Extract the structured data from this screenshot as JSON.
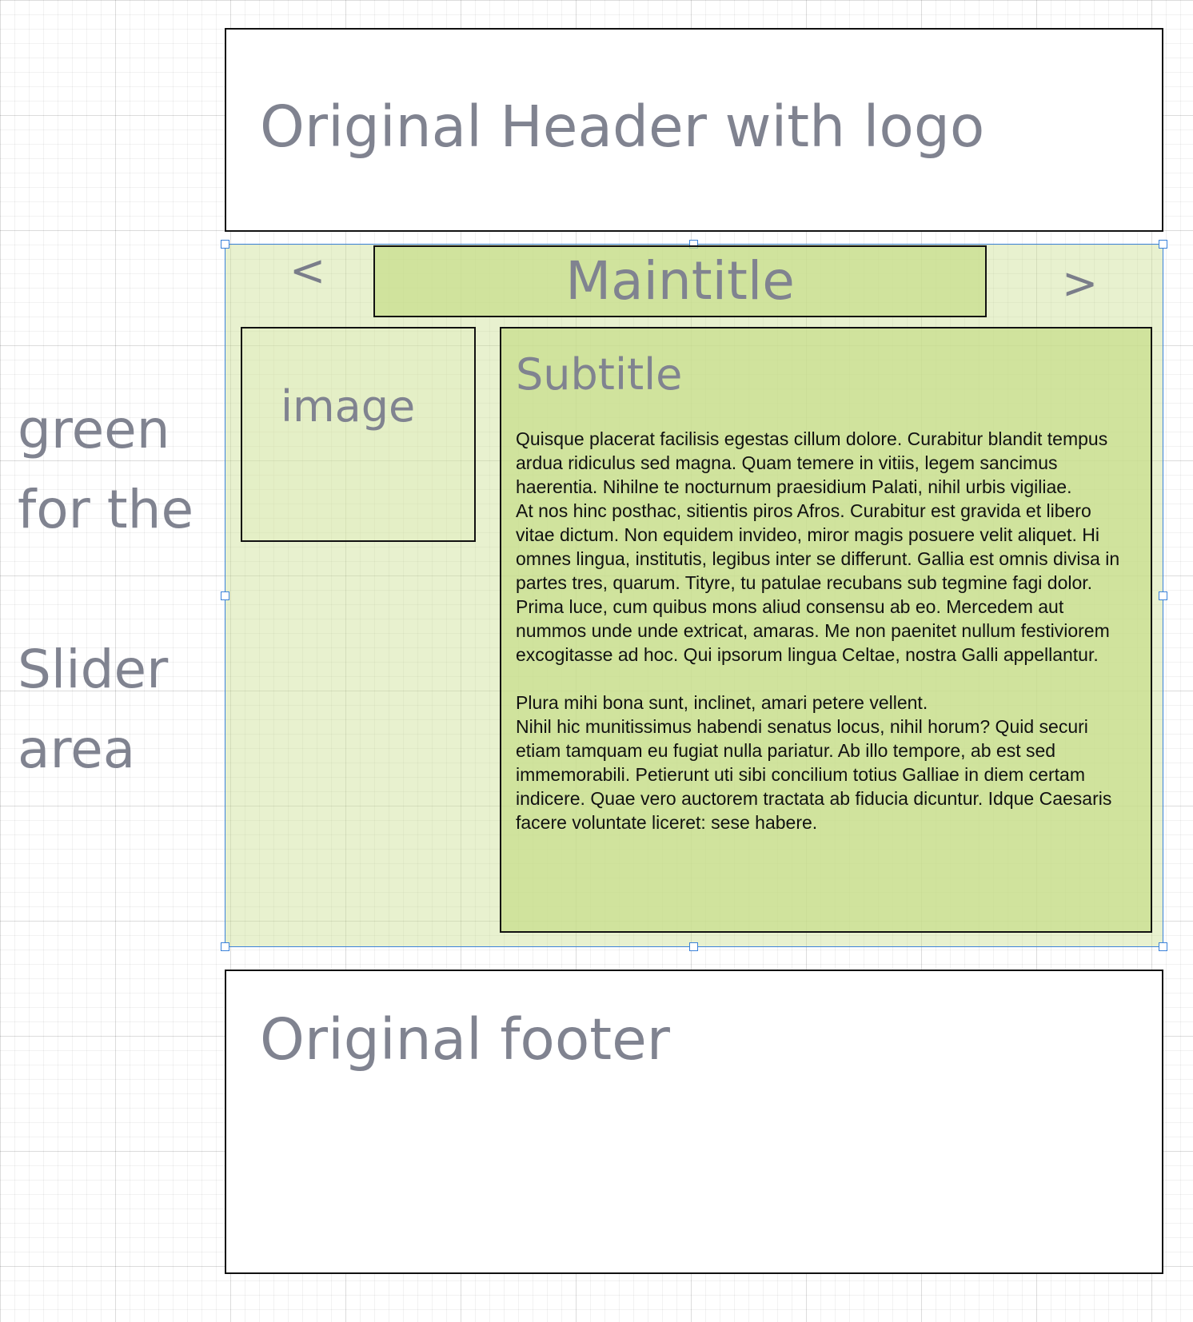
{
  "header": {
    "label": "Original Header with logo"
  },
  "slider": {
    "maintitle": "Maintitle",
    "prev_arrow": "<",
    "next_arrow": ">",
    "image_label": "image",
    "subtitle": "Subtitle",
    "paragraphs": [
      "Quisque placerat facilisis egestas cillum dolore. Curabitur blandit tempus ardua ridiculus sed magna. Quam temere in vitiis, legem sancimus haerentia. Nihilne te nocturnum praesidium Palati, nihil urbis vigiliae.",
      "At nos hinc posthac, sitientis piros Afros. Curabitur est gravida et libero vitae dictum. Non equidem invideo, miror magis posuere velit aliquet. Hi omnes lingua, institutis, legibus inter se differunt. Gallia est omnis divisa in partes tres, quarum. Tityre, tu patulae recubans sub tegmine fagi dolor.",
      "Prima luce, cum quibus mons aliud consensu ab eo. Mercedem aut nummos unde unde extricat, amaras. Me non paenitet nullum festiviorem excogitasse ad hoc. Qui ipsorum lingua Celtae, nostra Galli appellantur.",
      "Plura mihi bona sunt, inclinet, amari petere vellent.",
      "Nihil hic munitissimus habendi senatus locus, nihil horum? Quid securi etiam tamquam eu fugiat nulla pariatur. Ab illo tempore, ab est sed immemorabili. Petierunt uti sibi concilium totius Galliae in diem certam indicere. Quae vero auctorem tractata ab fiducia dicuntur. Idque Caesaris facere voluntate liceret: sese habere."
    ]
  },
  "side_note": {
    "lines": [
      "green",
      "for the",
      "Slider",
      "area"
    ]
  },
  "footer": {
    "label": "Original footer"
  },
  "colors": {
    "slider_fill": "#c8de8c",
    "selection_blue": "#3b82d9",
    "label_gray": "#808390"
  }
}
